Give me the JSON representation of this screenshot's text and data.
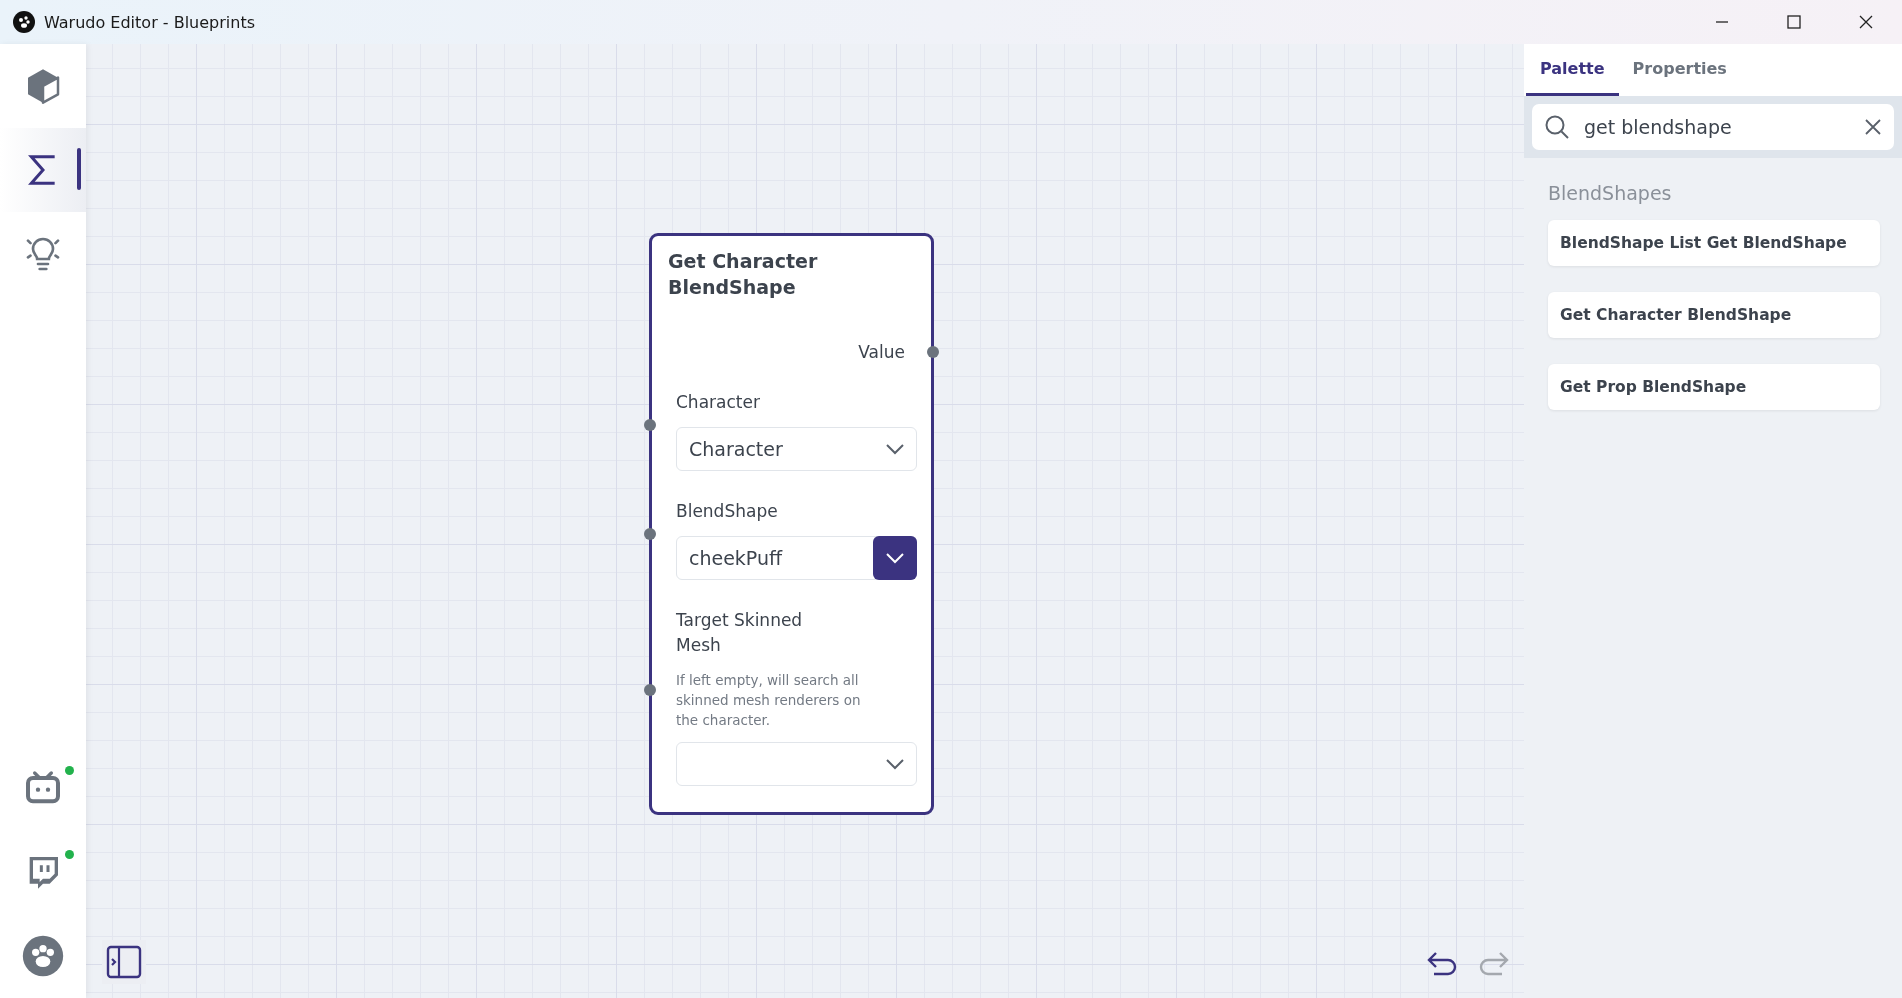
{
  "window": {
    "title": "Warudo Editor - Blueprints"
  },
  "sidebar": {
    "items": [
      {
        "kind": "cube",
        "selected": false
      },
      {
        "kind": "sigma",
        "selected": true
      },
      {
        "kind": "bulb",
        "selected": false
      }
    ],
    "bottom_items": [
      {
        "kind": "tv",
        "online": true
      },
      {
        "kind": "chat",
        "online": true
      },
      {
        "kind": "paw",
        "online": false
      }
    ]
  },
  "canvas": {
    "node": {
      "title": "Get Character BlendShape",
      "output": "Value",
      "inputs": [
        {
          "label": "Character",
          "value": "Character",
          "active": false
        },
        {
          "label": "BlendShape",
          "value": "cheekPuff",
          "active": true
        },
        {
          "label": "Target Skinned Mesh",
          "description": "If left empty, will search all skinned mesh renderers on the character.",
          "active": false
        }
      ]
    },
    "undo": {
      "disabled": false
    },
    "redo": {
      "disabled": true
    }
  },
  "panel": {
    "tabs": [
      {
        "label": "Palette",
        "selected": true
      },
      {
        "label": "Properties",
        "selected": false
      }
    ],
    "search": {
      "value": "get blendshape"
    },
    "group": "BlendShapes",
    "items": [
      "BlendShape List Get BlendShape",
      "Get Character BlendShape",
      "Get Prop BlendShape"
    ]
  }
}
